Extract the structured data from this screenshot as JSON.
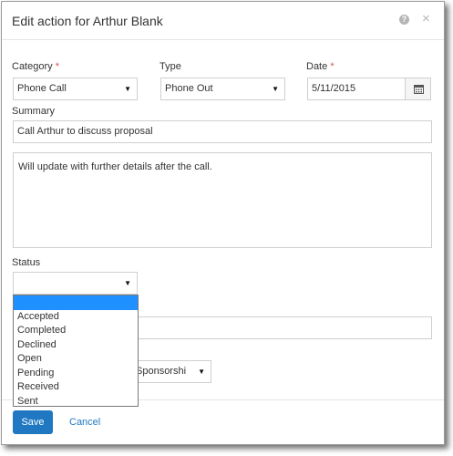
{
  "dialog": {
    "title": "Edit action for Arthur Blank",
    "help_icon": "?",
    "close_icon": "×"
  },
  "form": {
    "category": {
      "label": "Category",
      "required_mark": "*",
      "value": "Phone Call"
    },
    "type": {
      "label": "Type",
      "value": "Phone Out"
    },
    "date": {
      "label": "Date",
      "required_mark": "*",
      "value": "5/11/2015",
      "icon": "calendar-icon"
    },
    "summary": {
      "label": "Summary",
      "value": "Call Arthur to discuss proposal"
    },
    "notes": {
      "value": "Will update with further details after the call."
    },
    "status": {
      "label": "Status",
      "value": "",
      "options": [
        "",
        "Accepted",
        "Completed",
        "Declined",
        "Open",
        "Pending",
        "Received",
        "Sent"
      ]
    },
    "hidden_select": {
      "partial_value": "Sponsorshi"
    }
  },
  "footer": {
    "save_label": "Save",
    "cancel_label": "Cancel"
  },
  "colors": {
    "accent": "#1f78c1",
    "required": "#d9534f",
    "selected_option": "#1e90ff"
  }
}
